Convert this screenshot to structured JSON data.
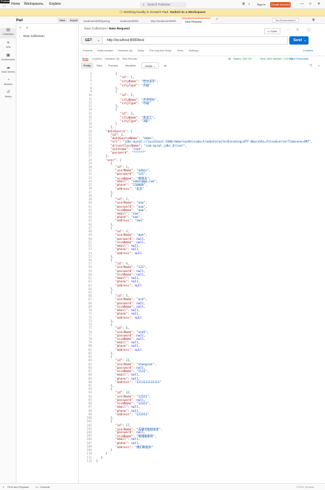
{
  "window_label": "Postman",
  "nav": {
    "home": "Home",
    "workspaces": "Workspaces",
    "explore": "Explore"
  },
  "search": {
    "placeholder": "Search Postman"
  },
  "account": {
    "sign_in": "Sign In",
    "create_account": "Create Account"
  },
  "banner": {
    "text": "Working locally in Scratch Pad.",
    "link": "Switch to a Workspace"
  },
  "workspace": {
    "name": "Scratch Pad",
    "new": "New",
    "import": "Import"
  },
  "sidebar": [
    {
      "label": "Collections",
      "icon": "collections-icon"
    },
    {
      "label": "APIs",
      "icon": "apis-icon"
    },
    {
      "label": "Environments",
      "icon": "environments-icon"
    },
    {
      "label": "Mock Servers",
      "icon": "mock-servers-icon"
    },
    {
      "label": "Monitors",
      "icon": "monitors-icon"
    },
    {
      "label": "History",
      "icon": "history-icon"
    }
  ],
  "tree": {
    "item": "New Collection"
  },
  "tabs": [
    {
      "label": "localhost:8080/pachg",
      "active": false
    },
    {
      "label": "localhost:8080/",
      "active": false
    },
    {
      "label": "http://localhost:8080/",
      "active": false
    },
    {
      "label": "New Request",
      "active": true
    }
  ],
  "environment": "No Environment",
  "breadcrumb": {
    "collection": "New Collection",
    "request": "New Request"
  },
  "actions": {
    "save": "Save"
  },
  "request": {
    "method": "GET",
    "url": "http://localhost:8080/test",
    "send": "Send"
  },
  "request_tabs": [
    "Params",
    "Authorization",
    "Headers (6)",
    "Body",
    "Pre-request Script",
    "Tests",
    "Settings"
  ],
  "cookies_link": "Cookies",
  "response_tabs": [
    "Body",
    "Cookies",
    "Headers (5)",
    "Test Results"
  ],
  "response_status": {
    "status": "Status: 200 OK",
    "time": "Time: 843 ms",
    "size": "Size: 1.64 KB",
    "save": "Save Response"
  },
  "format_bar": {
    "pretty": "Pretty",
    "raw": "Raw",
    "preview": "Preview",
    "visualize": "Visualize",
    "format": "JSON"
  },
  "footer": {
    "find_replace": "Find and Replace",
    "console": "Console",
    "watermark": "CSDN @dalao"
  },
  "code_lines": [
    {
      "n": 4,
      "i": 4,
      "t": "{"
    },
    {
      "n": 5,
      "i": 5,
      "k": "id",
      "v": "1",
      "c": ","
    },
    {
      "n": 6,
      "i": 5,
      "k": "cityName",
      "v": "\"哈尔滨市\"",
      "c": ","
    },
    {
      "n": 7,
      "i": 5,
      "k": "cityType",
      "v": "\"市级\""
    },
    {
      "n": 8,
      "i": 4,
      "t": "},"
    },
    {
      "n": 9,
      "i": 4,
      "t": "{"
    },
    {
      "n": 10,
      "i": 5,
      "k": "id",
      "v": "2",
      "c": ","
    },
    {
      "n": 11,
      "i": 5,
      "k": "cityName",
      "v": "\"齐齐哈尔\"",
      "c": ","
    },
    {
      "n": 12,
      "i": 5,
      "k": "cityType",
      "v": "\"市级\""
    },
    {
      "n": 13,
      "i": 4,
      "t": "},"
    },
    {
      "n": 14,
      "i": 4,
      "t": "{"
    },
    {
      "n": 15,
      "i": 5,
      "k": "id",
      "v": "3",
      "c": ","
    },
    {
      "n": 16,
      "i": 5,
      "k": "cityName",
      "v": "\"黑龙江\"",
      "c": ","
    },
    {
      "n": 17,
      "i": 5,
      "k": "cityType",
      "v": "\"3级\""
    },
    {
      "n": 18,
      "i": 4,
      "t": "}"
    },
    {
      "n": 19,
      "i": 3,
      "t": "],"
    },
    {
      "n": 20,
      "i": 2,
      "k": "dataSource",
      "t2": "{"
    },
    {
      "n": 21,
      "i": 3,
      "k": "id",
      "v": "1",
      "c": ","
    },
    {
      "n": 22,
      "i": 3,
      "k": "dataSourceName",
      "v": "\"demo\"",
      "c": ","
    },
    {
      "n": 23,
      "i": 3,
      "k": "url",
      "v": "\"jdbc:mysql://localhost:3306/demo?useUnicode=true&characterEncoding=UTF-8&useSSL=false&serverTimezone=GMT\"",
      "c": ","
    },
    {
      "n": 24,
      "i": 3,
      "k": "driverClassName",
      "v": "\"com.mysql.jdbc.Driver\"",
      "c": ","
    },
    {
      "n": 25,
      "i": 3,
      "k": "username",
      "v": "\"root\"",
      "c": ","
    },
    {
      "n": 26,
      "i": 3,
      "k": "password",
      "v": "\"******\""
    },
    {
      "n": 27,
      "i": 2,
      "t": "},"
    },
    {
      "n": 28,
      "i": 2,
      "k": "user",
      "t2": "["
    },
    {
      "n": 29,
      "i": 3,
      "t": "{"
    },
    {
      "n": 30,
      "i": 4,
      "k": "id",
      "v": "1",
      "c": ","
    },
    {
      "n": 31,
      "i": 4,
      "k": "userName",
      "v": "\"admin\"",
      "c": ","
    },
    {
      "n": 32,
      "i": 4,
      "k": "password",
      "v": "\"123\"",
      "c": ","
    },
    {
      "n": 33,
      "i": 4,
      "k": "nickName",
      "v": "\"管理员\"",
      "c": ","
    },
    {
      "n": 34,
      "i": 4,
      "k": "email",
      "v": "\"admin@qq.com\"",
      "c": ","
    },
    {
      "n": 35,
      "i": 4,
      "k": "phone",
      "v": "\"110000\"",
      "c": ","
    },
    {
      "n": 36,
      "i": 4,
      "k": "address",
      "v": "\"北京\""
    },
    {
      "n": 37,
      "i": 3,
      "t": "},"
    },
    {
      "n": 38,
      "i": 3,
      "t": "{"
    },
    {
      "n": 39,
      "i": 4,
      "k": "id",
      "v": "2",
      "c": ","
    },
    {
      "n": 40,
      "i": 4,
      "k": "userName",
      "v": "\"aaa\"",
      "c": ","
    },
    {
      "n": 41,
      "i": 4,
      "k": "password",
      "v": "\"aaa\"",
      "c": ","
    },
    {
      "n": 42,
      "i": 4,
      "k": "nickName",
      "v": "\"aaa\"",
      "c": ","
    },
    {
      "n": 43,
      "i": 4,
      "k": "email",
      "v": "\"aaa\"",
      "c": ","
    },
    {
      "n": 44,
      "i": 4,
      "k": "phone",
      "v": "\"aaa\"",
      "c": ","
    },
    {
      "n": 45,
      "i": 4,
      "k": "address",
      "v": "\"aaa\""
    },
    {
      "n": 46,
      "i": 3,
      "t": "},"
    },
    {
      "n": 47,
      "i": 3,
      "t": "{"
    },
    {
      "n": 48,
      "i": 4,
      "k": "id",
      "v": "3",
      "c": ","
    },
    {
      "n": 49,
      "i": 4,
      "k": "userName",
      "v": "\"qwe\"",
      "c": ","
    },
    {
      "n": 50,
      "i": 4,
      "k": "password",
      "v": "null",
      "c": ","
    },
    {
      "n": 51,
      "i": 4,
      "k": "nickName",
      "v": "null",
      "c": ","
    },
    {
      "n": 52,
      "i": 4,
      "k": "email",
      "v": "null",
      "c": ","
    },
    {
      "n": 53,
      "i": 4,
      "k": "phone",
      "v": "null",
      "c": ","
    },
    {
      "n": 54,
      "i": 4,
      "k": "address",
      "v": "null"
    },
    {
      "n": 55,
      "i": 3,
      "t": "},"
    },
    {
      "n": 56,
      "i": 3,
      "t": "{"
    },
    {
      "n": 57,
      "i": 4,
      "k": "id",
      "v": "4",
      "c": ","
    },
    {
      "n": 58,
      "i": 4,
      "k": "userName",
      "v": "\"123\"",
      "c": ","
    },
    {
      "n": 59,
      "i": 4,
      "k": "password",
      "v": "null",
      "c": ","
    },
    {
      "n": 60,
      "i": 4,
      "k": "nickName",
      "v": "null",
      "c": ","
    },
    {
      "n": 61,
      "i": 4,
      "k": "email",
      "v": "null",
      "c": ","
    },
    {
      "n": 62,
      "i": 4,
      "k": "phone",
      "v": "null",
      "c": ","
    },
    {
      "n": 63,
      "i": 4,
      "k": "address",
      "v": "null"
    },
    {
      "n": 64,
      "i": 3,
      "t": "},"
    },
    {
      "n": 65,
      "i": 3,
      "t": "{"
    },
    {
      "n": 66,
      "i": 4,
      "k": "id",
      "v": "5",
      "c": ","
    },
    {
      "n": 67,
      "i": 4,
      "k": "userName",
      "v": "\"asd\"",
      "c": ","
    },
    {
      "n": 68,
      "i": 4,
      "k": "password",
      "v": "null",
      "c": ","
    },
    {
      "n": 69,
      "i": 4,
      "k": "nickName",
      "v": "null",
      "c": ","
    },
    {
      "n": 70,
      "i": 4,
      "k": "email",
      "v": "null",
      "c": ","
    },
    {
      "n": 71,
      "i": 4,
      "k": "phone",
      "v": "null",
      "c": ","
    },
    {
      "n": 72,
      "i": 4,
      "k": "address",
      "v": "null"
    },
    {
      "n": 73,
      "i": 3,
      "t": "},"
    },
    {
      "n": 74,
      "i": 3,
      "t": "{"
    },
    {
      "n": 75,
      "i": 4,
      "k": "id",
      "v": "6",
      "c": ","
    },
    {
      "n": 76,
      "i": 4,
      "k": "userName",
      "v": "\"asd1\"",
      "c": ","
    },
    {
      "n": 77,
      "i": 4,
      "k": "password",
      "v": "null",
      "c": ","
    },
    {
      "n": 78,
      "i": 4,
      "k": "nickName",
      "v": "null",
      "c": ","
    },
    {
      "n": 79,
      "i": 4,
      "k": "email",
      "v": "null",
      "c": ","
    },
    {
      "n": 80,
      "i": 4,
      "k": "phone",
      "v": "null",
      "c": ","
    },
    {
      "n": 81,
      "i": 4,
      "k": "address",
      "v": "null"
    },
    {
      "n": 82,
      "i": 3,
      "t": "},"
    },
    {
      "n": 83,
      "i": 3,
      "t": "{"
    },
    {
      "n": 84,
      "i": 4,
      "k": "id",
      "v": "11",
      "c": ","
    },
    {
      "n": 85,
      "i": 4,
      "k": "userName",
      "v": "\"zhangsan\"",
      "c": ","
    },
    {
      "n": 86,
      "i": 4,
      "k": "password",
      "v": "null",
      "c": ","
    },
    {
      "n": 87,
      "i": 4,
      "k": "nickName",
      "v": "\"1111\"",
      "c": ","
    },
    {
      "n": 88,
      "i": 4,
      "k": "email",
      "v": "null",
      "c": ","
    },
    {
      "n": 89,
      "i": 4,
      "k": "phone",
      "v": "null",
      "c": ","
    },
    {
      "n": 90,
      "i": 4,
      "k": "address",
      "v": "\"1111111111111\""
    },
    {
      "n": 91,
      "i": 3,
      "t": "},"
    },
    {
      "n": 92,
      "i": 3,
      "t": "{"
    },
    {
      "n": 93,
      "i": 4,
      "k": "id",
      "v": "12",
      "c": ","
    },
    {
      "n": 94,
      "i": 4,
      "k": "userName",
      "v": "\"12321\"",
      "c": ","
    },
    {
      "n": 95,
      "i": 4,
      "k": "password",
      "v": "null",
      "c": ","
    },
    {
      "n": 96,
      "i": 4,
      "k": "nickName",
      "v": "\"12321\"",
      "c": ","
    },
    {
      "n": 97,
      "i": 4,
      "k": "email",
      "v": "null",
      "c": ","
    },
    {
      "n": 98,
      "i": 4,
      "k": "phone",
      "v": "null",
      "c": ","
    },
    {
      "n": 99,
      "i": 4,
      "k": "address",
      "v": "\"123213\""
    },
    {
      "n": 100,
      "i": 3,
      "t": "},"
    },
    {
      "n": 101,
      "i": 3,
      "t": "{"
    },
    {
      "n": 102,
      "i": 4,
      "k": "id",
      "v": "17",
      "c": ","
    },
    {
      "n": 103,
      "i": 4,
      "k": "userName",
      "v": "\"去哪可能搞家里\"",
      "c": ","
    },
    {
      "n": 104,
      "i": 4,
      "k": "password",
      "v": "null",
      "c": ","
    },
    {
      "n": 105,
      "i": 4,
      "k": "nickName",
      "v": "\"哦哦看看吧\"",
      "c": ","
    },
    {
      "n": 106,
      "i": 4,
      "k": "email",
      "v": "null",
      "c": ","
    },
    {
      "n": 107,
      "i": 4,
      "k": "phone",
      "v": "null",
      "c": ","
    },
    {
      "n": 108,
      "i": 4,
      "k": "address",
      "v": "\"偶们啊就你\""
    },
    {
      "n": 109,
      "i": 3,
      "t": "}"
    },
    {
      "n": 110,
      "i": 2,
      "t": "]"
    },
    {
      "n": 111,
      "i": 1,
      "t": "}"
    },
    {
      "n": 112,
      "i": 0,
      "t": "}"
    }
  ]
}
